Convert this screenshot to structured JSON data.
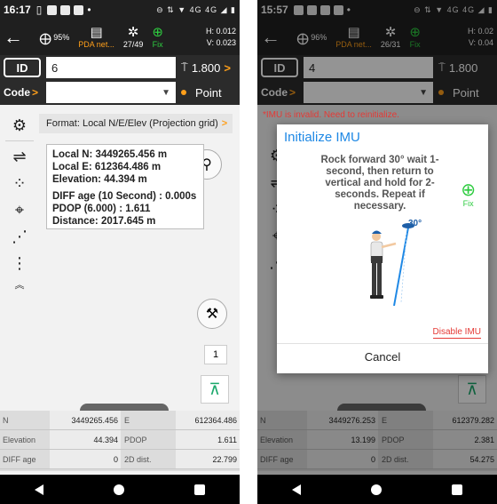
{
  "left": {
    "status": {
      "time": "16:17",
      "icons": "⊖ ⇅ ▼ 4G 4G ◢ ▮"
    },
    "toolbar": {
      "battery": "95%",
      "pda": "PDA net...",
      "sats": "27/49",
      "fix": "Fix",
      "h": "H: 0.012",
      "v": "V: 0.023"
    },
    "id_label": "ID",
    "id_value": "6",
    "height": "1.800",
    "code_label": "Code",
    "point_type": "Point",
    "format": "Format: Local N/E/Elev (Projection grid)",
    "info": {
      "local_n": "Local N: 3449265.456 m",
      "local_e": "Local E: 612364.486 m",
      "elev": "Elevation: 44.394 m",
      "diff": "DIFF age (10 Second) : 0.000s",
      "pdop": "PDOP (6.000) : 1.611",
      "dist": "Distance: 2017.645 m"
    },
    "counter": "1",
    "table": [
      {
        "k1": "N",
        "v1": "3449265.456",
        "k2": "E",
        "v2": "612364.486"
      },
      {
        "k1": "Elevation",
        "v1": "44.394",
        "k2": "PDOP",
        "v2": "1.611"
      },
      {
        "k1": "DIFF age",
        "v1": "0",
        "k2": "2D dist.",
        "v2": "22.799"
      }
    ]
  },
  "right": {
    "status": {
      "time": "15:57",
      "icons": "⊖ ⇅ ▼ 4G 4G ◢ ▮"
    },
    "toolbar": {
      "battery": "96%",
      "pda": "PDA net...",
      "sats": "26/31",
      "fix": "Fix",
      "h": "H: 0.02",
      "v": "V: 0.04"
    },
    "id_label": "ID",
    "id_value": "4",
    "height": "1.800",
    "code_label": "Code",
    "point_type": "Point",
    "imu_warning": "*IMU is invalid. Need to reinitialize.",
    "dialog": {
      "title": "Initialize IMU",
      "message": "Rock forward 30° wait 1-second, then return to vertical and hold for 2-seconds. Repeat if necessary.",
      "fix": "Fix",
      "angle": "30°",
      "disable": "Disable IMU",
      "cancel": "Cancel"
    },
    "table": [
      {
        "k1": "N",
        "v1": "3449276.253",
        "k2": "E",
        "v2": "612379.282"
      },
      {
        "k1": "Elevation",
        "v1": "13.199",
        "k2": "PDOP",
        "v2": "2.381"
      },
      {
        "k1": "DIFF age",
        "v1": "0",
        "k2": "2D dist.",
        "v2": "54.275"
      }
    ]
  }
}
